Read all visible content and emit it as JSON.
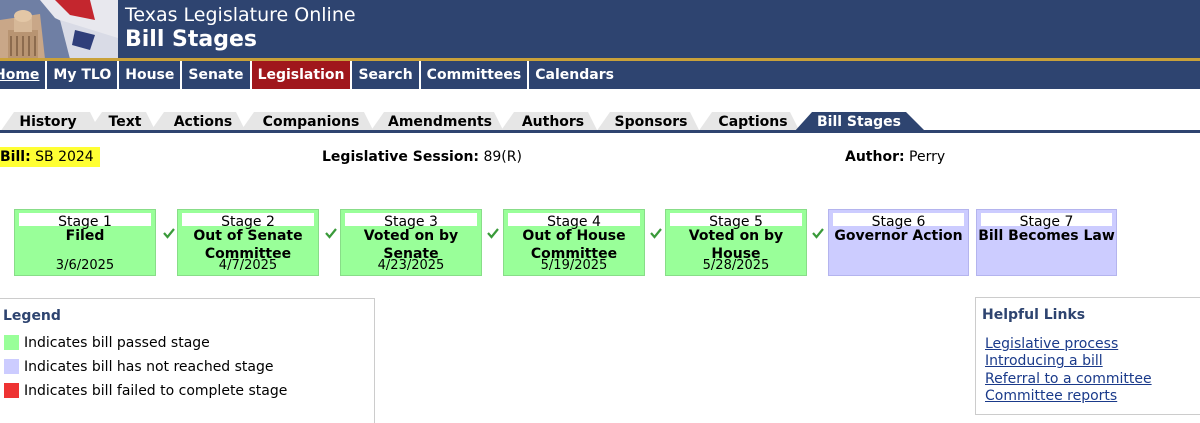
{
  "header": {
    "site_title": "Texas Legislature Online",
    "page_title": "Bill Stages"
  },
  "mainnav": [
    {
      "label": "Home",
      "active": false
    },
    {
      "label": "My TLO",
      "active": false
    },
    {
      "label": "House",
      "active": false
    },
    {
      "label": "Senate",
      "active": false
    },
    {
      "label": "Legislation",
      "active": true
    },
    {
      "label": "Search",
      "active": false
    },
    {
      "label": "Committees",
      "active": false
    },
    {
      "label": "Calendars",
      "active": false
    }
  ],
  "tabs": [
    {
      "label": "History"
    },
    {
      "label": "Text"
    },
    {
      "label": "Actions"
    },
    {
      "label": "Companions"
    },
    {
      "label": "Amendments"
    },
    {
      "label": "Authors"
    },
    {
      "label": "Sponsors"
    },
    {
      "label": "Captions"
    },
    {
      "label": "Bill Stages",
      "active": true
    }
  ],
  "bill": {
    "label": "Bill:",
    "number": "SB 2024",
    "session_label": "Legislative Session:",
    "session": "89(R)",
    "author_label": "Author:",
    "author": "Perry"
  },
  "stages": [
    {
      "head": "Stage 1",
      "name": "Filed",
      "date": "3/6/2025",
      "status": "passed"
    },
    {
      "head": "Stage 2",
      "name": "Out of Senate Committee",
      "date": "4/7/2025",
      "status": "passed"
    },
    {
      "head": "Stage 3",
      "name": "Voted on by Senate",
      "date": "4/23/2025",
      "status": "passed"
    },
    {
      "head": "Stage 4",
      "name": "Out of House Committee",
      "date": "5/19/2025",
      "status": "passed"
    },
    {
      "head": "Stage 5",
      "name": "Voted on by House",
      "date": "5/28/2025",
      "status": "passed"
    },
    {
      "head": "Stage 6",
      "name": "Governor Action",
      "date": "",
      "status": "pending"
    },
    {
      "head": "Stage 7",
      "name": "Bill Becomes Law",
      "date": "",
      "status": "pending"
    }
  ],
  "legend": {
    "title": "Legend",
    "items": [
      {
        "text": "Indicates bill passed stage",
        "color": "#99ff99"
      },
      {
        "text": "Indicates bill has not reached stage",
        "color": "#ccccff"
      },
      {
        "text": "Indicates bill failed to complete stage",
        "color": "#ee3333"
      }
    ]
  },
  "helpful_links": {
    "title": "Helpful Links",
    "items": [
      "Legislative process",
      "Introducing a bill",
      "Referral to a committee",
      "Committee reports"
    ]
  },
  "colors": {
    "header_bg": "#2e4470",
    "active_nav": "#a0171c",
    "gold_rule": "#c9a13a",
    "passed": "#99ff99",
    "pending": "#ccccff",
    "failed": "#ee3333",
    "bill_highlight": "#ffff33"
  }
}
